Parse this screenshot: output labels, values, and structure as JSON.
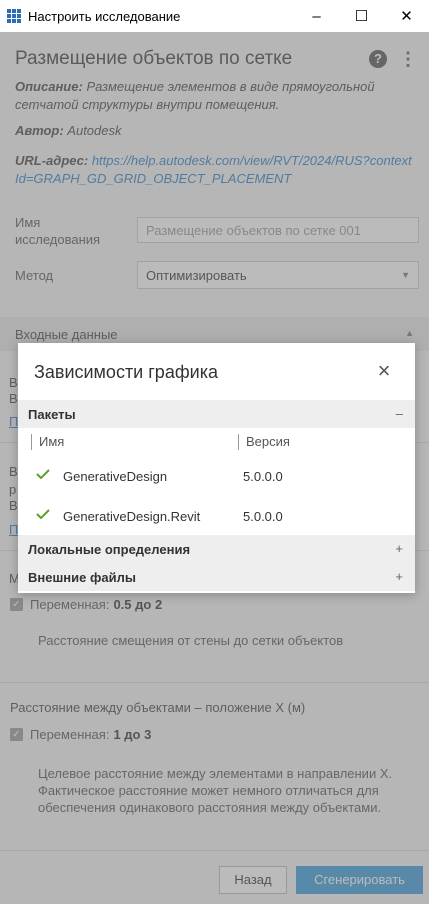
{
  "window": {
    "title": "Настроить исследование",
    "minimize": "–",
    "maximize": "☐",
    "close": "✕"
  },
  "page": {
    "title": "Размещение объектов по сетке",
    "help": "?",
    "more": "⋮",
    "description_label": "Описание:",
    "description_text": "Размещение элементов в виде прямоугольной сетчатой структуры внутри помещения.",
    "author_label": "Автор:",
    "author_value": "Autodesk",
    "url_label": "URL-адрес:",
    "url_value": "https://help.autodesk.com/view/RVT/2024/RUS?contextId=GRAPH_GD_GRID_OBJECT_PLACEMENT",
    "study_name_label": "Имя исследования",
    "study_name_placeholder": "Размещение объектов по сетке 001",
    "method_label": "Метод",
    "method_value": "Оптимизировать",
    "inputs_header": "Входные данные",
    "partial_1a": "В",
    "partial_1b": "В",
    "partial_1c": "П",
    "partial_2a": "В",
    "partial_2b": "р",
    "partial_2c": "В",
    "partial_2d": "П",
    "partial_3": "М",
    "param1_variable_label": "Переменная:",
    "param1_range": "0.5 до 2",
    "param1_help": "Расстояние смещения от стены до сетки объектов",
    "param2_title": "Расстояние между объектами – положение X (м)",
    "param2_variable_label": "Переменная:",
    "param2_range": "1 до 3",
    "param2_help": "Целевое расстояние между элементами в направлении X. Фактическое расстояние может немного отличаться для обеспечения одинакового расстояния между объектами.",
    "back_button": "Назад",
    "generate_button": "Сгенерировать"
  },
  "modal": {
    "title": "Зависимости графика",
    "close": "×",
    "packages_header": "Пакеты",
    "packages_toggle": "–",
    "col_name": "Имя",
    "col_version": "Версия",
    "packages": [
      {
        "name": "GenerativeDesign",
        "version": "5.0.0.0"
      },
      {
        "name": "GenerativeDesign.Revit",
        "version": "5.0.0.0"
      }
    ],
    "local_header": "Локальные определения",
    "local_toggle": "+",
    "external_header": "Внешние файлы",
    "external_toggle": "+"
  },
  "colors": {
    "accent": "#3a9bd9",
    "link": "#2a7fc9",
    "check_green": "#5aa02c"
  }
}
